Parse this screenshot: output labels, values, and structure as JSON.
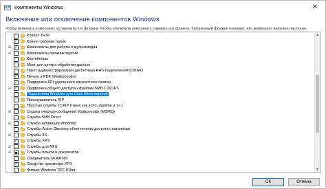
{
  "window": {
    "title": "Компоненты Windows",
    "close_glyph": "✕"
  },
  "heading": "Включение или отключение компонентов Windows",
  "instruction": "Чтобы включить компонент, установите его флажок. Чтобы отключить компонент, снимите его флажок. Затененный флажок означает, что компонент включен частично.",
  "tree": {
    "items": [
      {
        "label": "Клиент TFTP",
        "state": "unchecked",
        "expandable": false
      },
      {
        "label": "Клиент рабочих папок",
        "state": "checked",
        "expandable": false
      },
      {
        "label": "Компоненты для работы с мультимедиа",
        "state": "checked",
        "expandable": true
      },
      {
        "label": "Компоненты прежних версий",
        "state": "unchecked",
        "expandable": true
      },
      {
        "label": "Контейнеры",
        "state": "unchecked",
        "expandable": false
      },
      {
        "label": "Мост для центра обработки данных",
        "state": "unchecked",
        "expandable": false
      },
      {
        "label": "Пакет администрирования диспетчера RAS-подключений (CMAK)",
        "state": "unchecked",
        "expandable": false
      },
      {
        "label": "Печать в PDF (Майкрософт)",
        "state": "checked",
        "expandable": false
      },
      {
        "label": "Поддержка API удаленного разностного сжатия",
        "state": "checked",
        "expandable": false
      },
      {
        "label": "Поддержка общего доступа к файлам SMB 1.0/CIFS",
        "state": "checked",
        "expandable": true
      },
      {
        "label": "Подсистема Windows для Linux (бета-версия)",
        "state": "unchecked",
        "expandable": false,
        "selected": true
      },
      {
        "label": "Прослушиватель RIP",
        "state": "unchecked",
        "expandable": false
      },
      {
        "label": "Простые службы TCPIP (такие как echo, daytime и т.п.)",
        "state": "unchecked",
        "expandable": false
      },
      {
        "label": "Сервер очереди сообщений Майкрософт (MSMQ)",
        "state": "unchecked",
        "expandable": true
      },
      {
        "label": "Служба SMB Direct",
        "state": "unchecked",
        "expandable": false
      },
      {
        "label": "Служба активации Windows",
        "state": "unchecked",
        "expandable": true
      },
      {
        "label": "Службы Active Directory облегченного доступа к каталогам",
        "state": "unchecked",
        "expandable": false
      },
      {
        "label": "Службы IIS",
        "state": "unchecked",
        "expandable": true
      },
      {
        "label": "Службы XPS",
        "state": "checked",
        "expandable": false
      },
      {
        "label": "Службы для NFS",
        "state": "unchecked",
        "expandable": true
      },
      {
        "label": "Службы печати и документов",
        "state": "partial",
        "expandable": true
      },
      {
        "label": "Соединитель MultiPoint",
        "state": "unchecked",
        "expandable": false
      },
      {
        "label": "Средство просмотра XPS",
        "state": "checked",
        "expandable": false
      },
      {
        "label": "Фильтр Windows TIFF IFilter",
        "state": "unchecked",
        "expandable": false
      }
    ]
  },
  "buttons": {
    "ok": "ОК",
    "cancel": "Отмена"
  },
  "colors": {
    "heading": "#1e3c8c",
    "selection": "#0078d7",
    "folder": "#e8bf52"
  }
}
